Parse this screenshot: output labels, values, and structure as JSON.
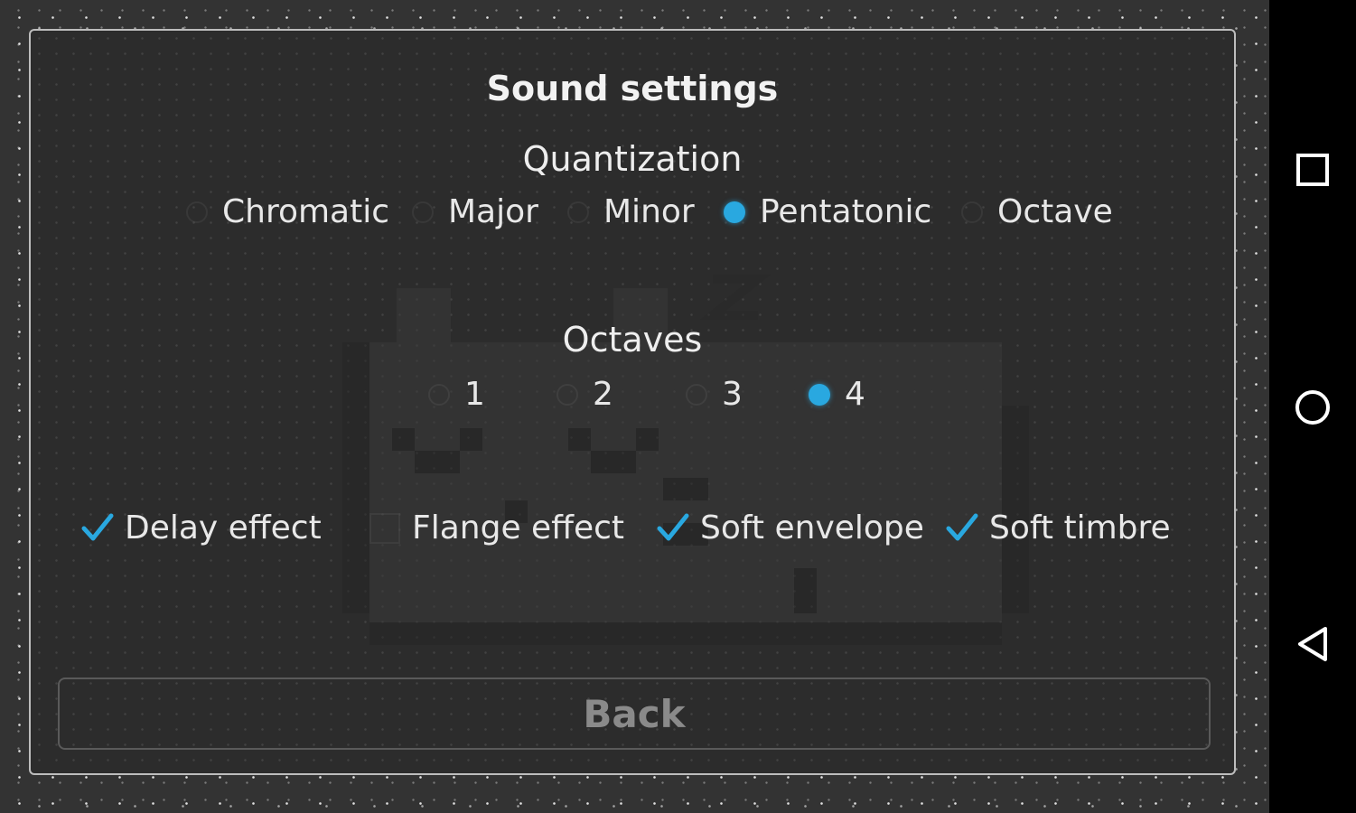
{
  "dialog": {
    "title": "Sound settings",
    "quantization": {
      "label": "Quantization",
      "options": [
        "Chromatic",
        "Major",
        "Minor",
        "Pentatonic",
        "Octave"
      ],
      "selected": "Pentatonic"
    },
    "octaves": {
      "label": "Octaves",
      "options": [
        "1",
        "2",
        "3",
        "4"
      ],
      "selected": "4"
    },
    "effects": [
      {
        "label": "Delay effect",
        "checked": true
      },
      {
        "label": "Flange effect",
        "checked": false
      },
      {
        "label": "Soft envelope",
        "checked": true
      },
      {
        "label": "Soft timbre",
        "checked": true
      }
    ],
    "back_label": "Back"
  },
  "colors": {
    "accent": "#29a8e0",
    "background": "#333333",
    "dialog_border": "#bdbdbd"
  },
  "navbar": {
    "icons": [
      "recent-apps-icon",
      "home-icon",
      "back-icon"
    ]
  }
}
